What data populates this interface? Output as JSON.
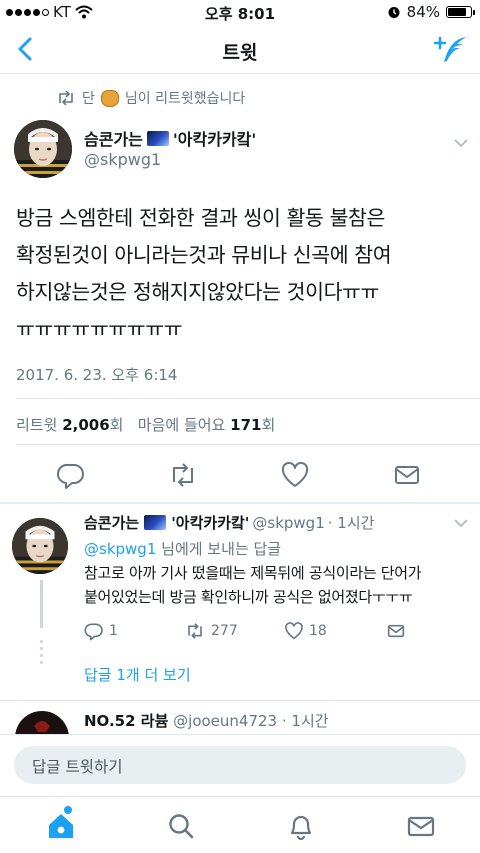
{
  "status_bar": {
    "carrier": "KT",
    "time": "오후 8:01",
    "battery": "84%",
    "battery_level": 0.84
  },
  "nav": {
    "title": "트윗",
    "back_icon": "chevron-left-icon",
    "compose_icon": "compose-tweet-icon",
    "accent": "#1da1f2"
  },
  "retweet_banner": {
    "prefix": "단",
    "suffix": "님이 리트윗했습니다"
  },
  "tweet": {
    "name_part1": "슴콘가는",
    "name_part2": "'아칵카카캌'",
    "handle": "@skpwg1",
    "text": "방금 스엠한테 전화한 결과 씽이 활동 불참은\n확정된것이 아니라는것과 뮤비나 신곡에 참여\n하지않는것은 정해지지않았다는 것이다ㅠㅠ\nㅠㅠㅠㅠㅠㅠㅠㅠㅠ",
    "timestamp": "2017. 6. 23. 오후 6:14",
    "retweets_label": "리트윗",
    "retweets": "2,006",
    "unit": "회",
    "likes_label": "마음에 들어요",
    "likes": "171"
  },
  "reply": {
    "name_part1": "슴콘가는",
    "name_part2": "'아칵카카캌'",
    "handle": "@skpwg1",
    "time": "· 1시간",
    "replying_handle": "@skpwg1",
    "replying_suffix": "님에게 보내는 답글",
    "text": "참고로 아까 기사 떴을때는 제목뒤에 공식이라는 단어가\n붙어있었는데 방금 확인하니까 공식은 없어졌다ㅜㅜㅠ",
    "replies": "1",
    "retweets": "277",
    "likes": "18"
  },
  "more_replies": "답글 1개 더 보기",
  "third": {
    "name": "NO.52 라븀",
    "handle": "@jooeun4723",
    "time": "· 1시간"
  },
  "compose": {
    "placeholder": "답글 트윗하기"
  }
}
